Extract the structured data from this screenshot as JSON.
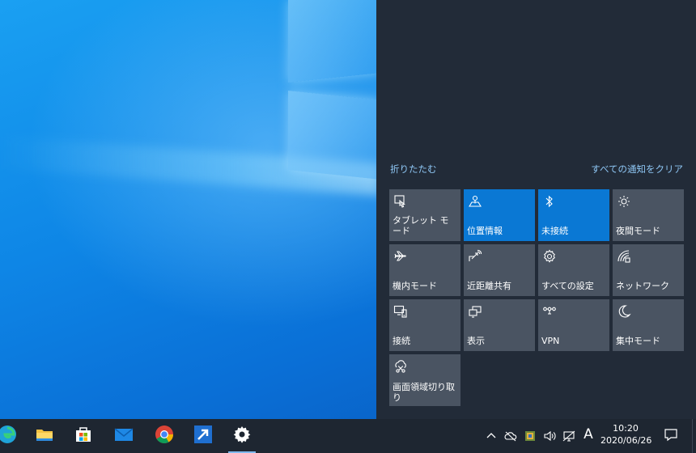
{
  "action_center": {
    "collapse_label": "折りたたむ",
    "clear_all_label": "すべての通知をクリア",
    "tiles": [
      {
        "label": "タブレット モード",
        "icon": "tablet-mode-icon",
        "on": false
      },
      {
        "label": "位置情報",
        "icon": "location-icon",
        "on": true
      },
      {
        "label": "未接続",
        "icon": "bluetooth-icon",
        "on": true
      },
      {
        "label": "夜間モード",
        "icon": "night-light-icon",
        "on": false
      },
      {
        "label": "機内モード",
        "icon": "airplane-icon",
        "on": false
      },
      {
        "label": "近距離共有",
        "icon": "nearby-share-icon",
        "on": false
      },
      {
        "label": "すべての設定",
        "icon": "settings-gear-icon",
        "on": false
      },
      {
        "label": "ネットワーク",
        "icon": "network-icon",
        "on": false
      },
      {
        "label": "接続",
        "icon": "connect-icon",
        "on": false
      },
      {
        "label": "表示",
        "icon": "project-icon",
        "on": false
      },
      {
        "label": "VPN",
        "icon": "vpn-icon",
        "on": false
      },
      {
        "label": "集中モード",
        "icon": "focus-assist-icon",
        "on": false
      },
      {
        "label": "画面領域切り取り",
        "icon": "snip-icon",
        "on": false
      }
    ],
    "colors": {
      "panel": "#222b38",
      "tile_off": "#4a5462",
      "tile_on": "#0a78d4",
      "link": "#8fc7f5"
    }
  },
  "taskbar": {
    "apps": [
      {
        "name": "edge-icon",
        "active": false
      },
      {
        "name": "file-explorer-icon",
        "active": false
      },
      {
        "name": "microsoft-store-icon",
        "active": false
      },
      {
        "name": "mail-icon",
        "active": false
      },
      {
        "name": "chrome-icon",
        "active": false
      },
      {
        "name": "shortcut-arrow-icon",
        "active": false
      },
      {
        "name": "settings-gear-icon",
        "active": true
      }
    ],
    "tray": {
      "ime_label": "A",
      "time": "10:20",
      "date": "2020/06/26"
    }
  }
}
